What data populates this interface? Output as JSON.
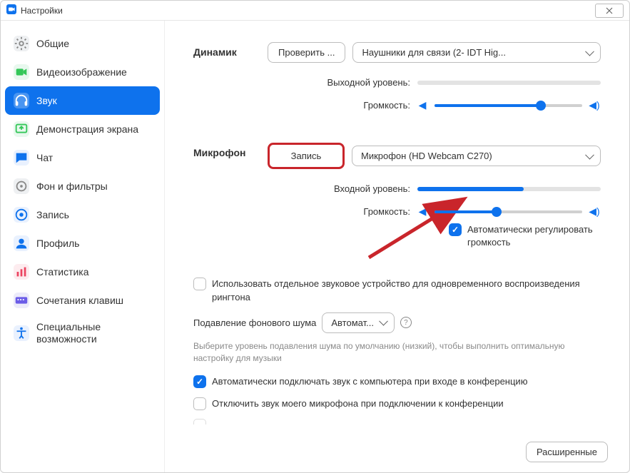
{
  "window": {
    "title": "Настройки"
  },
  "sidebar": {
    "items": [
      {
        "id": "general",
        "label": "Общие"
      },
      {
        "id": "video",
        "label": "Видеоизображение"
      },
      {
        "id": "audio",
        "label": "Звук"
      },
      {
        "id": "share",
        "label": "Демонстрация экрана"
      },
      {
        "id": "chat",
        "label": "Чат"
      },
      {
        "id": "background",
        "label": "Фон и фильтры"
      },
      {
        "id": "recording",
        "label": "Запись"
      },
      {
        "id": "profile",
        "label": "Профиль"
      },
      {
        "id": "statistics",
        "label": "Статистика"
      },
      {
        "id": "shortcuts",
        "label": "Сочетания клавиш"
      },
      {
        "id": "accessibility",
        "label": "Специальные возможности"
      }
    ],
    "activeIndex": 2
  },
  "speaker": {
    "heading": "Динамик",
    "test_button": "Проверить ...",
    "device": "Наушники для связи (2- IDT Hig...",
    "output_level_label": "Выходной уровень:",
    "output_level_percent": 0,
    "volume_label": "Громкость:",
    "volume_percent": 72
  },
  "mic": {
    "heading": "Микрофон",
    "record_button": "Запись",
    "device": "Микрофон (HD Webcam C270)",
    "input_level_label": "Входной уровень:",
    "input_level_percent": 58,
    "volume_label": "Громкость:",
    "volume_percent": 42,
    "auto_gain_label": "Автоматически регулировать громкость",
    "auto_gain_checked": true
  },
  "options": {
    "separate_device_label": "Использовать отдельное звуковое устройство для одновременного воспроизведения рингтона",
    "separate_device_checked": false,
    "noise_label": "Подавление фонового шума",
    "noise_value": "Автомат...",
    "noise_hint": "Выберите уровень подавления шума по умолчанию (низкий), чтобы выполнить оптимальную настройку для музыки",
    "auto_join_audio_label": "Автоматически подключать звук с компьютера при входе в конференцию",
    "auto_join_audio_checked": true,
    "mute_on_join_label": "Отключить звук моего микрофона при подключении к конференции",
    "mute_on_join_checked": false
  },
  "footer": {
    "advanced_button": "Расширенные"
  }
}
